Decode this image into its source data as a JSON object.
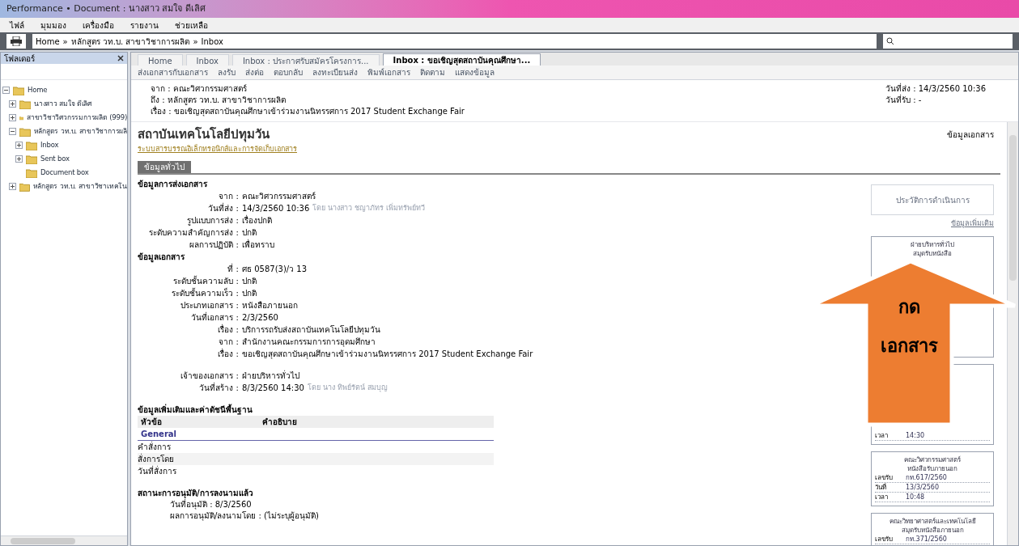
{
  "window": {
    "title": "Performance • Document : นางสาว สมใจ ดีเลิศ"
  },
  "menu": [
    "ไฟล์",
    "มุมมอง",
    "เครื่องมือ",
    "รายงาน",
    "ช่วยเหลือ"
  ],
  "address": {
    "separator": "»",
    "path": [
      "Home",
      "หลักสูตร วท.บ. สาขาวิชาการผลิต",
      "Inbox"
    ]
  },
  "folders": {
    "title": "โฟลเดอร์",
    "tree": [
      {
        "label": "Home",
        "expanded": true,
        "children": [
          {
            "label": "นางสาว สมใจ ดีเลิศ",
            "expanded": false
          },
          {
            "label": "สาขาวิชาวิศวกรรมการผลิต (999)",
            "expanded": false
          },
          {
            "label": "หลักสูตร วท.บ. สาขาวิชาการผลิ",
            "expanded": true,
            "children": [
              {
                "label": "Inbox",
                "expanded": false
              },
              {
                "label": "Sent box",
                "expanded": false
              },
              {
                "label": "Document box"
              }
            ]
          },
          {
            "label": "หลักสูตร วท.บ. สาขาวิชาเทคโน",
            "expanded": false
          }
        ]
      }
    ]
  },
  "tabs": [
    {
      "label": "Home",
      "selected": false
    },
    {
      "label": "Inbox",
      "selected": false
    },
    {
      "label": "Inbox : ประกาศรับสมัครโครงการ...",
      "selected": false
    },
    {
      "label": "Inbox : ขอเชิญสุดสถาบันคุณศึกษา...",
      "selected": true
    }
  ],
  "toolbar": [
    "ส่งเอกสารกับเอกสาร",
    "ลงรับ",
    "ส่งต่อ",
    "ตอบกลับ",
    "ลงทะเบียนส่ง",
    "พิมพ์เอกสาร",
    "ติดตาม",
    "แสดงข้อมูล"
  ],
  "header": {
    "lines": [
      "จาก : คณะวิศวกรรมศาสตร์",
      "ถึง : หลักสูตร วท.บ. สาขาวิชาการผลิต",
      "เรื่อง : ขอเชิญสุดสถาบันคุณศึกษาเข้าร่วมงานนิทรรศการ 2017 Student Exchange Fair"
    ],
    "dates": [
      "วันที่ส่ง : 14/3/2560 10:36",
      "วันที่รับ : -"
    ]
  },
  "document": {
    "title": "สถาบันเทคโนโลยีปทุมวัน",
    "subtitle": "ระบบสารบรรณอิเล็กทรอนิกส์และการจัดเก็บเอกสาร",
    "info_label": "ข้อมูลเอกสาร",
    "tab": "ข้อมูลทั่วไป",
    "sections": [
      {
        "title": "ข้อมูลการส่งเอกสาร",
        "rows": [
          {
            "label": "จาก :",
            "value": "คณะวิศวกรรมศาสตร์",
            "note": ""
          },
          {
            "label": "วันที่ส่ง :",
            "value": "14/3/2560 10:36",
            "note": "โดย นางสาว ชญาภัทร เพิ่มทรัพย์ทวี"
          },
          {
            "label": "รูปแบบการส่ง :",
            "value": "เรื่องปกติ",
            "note": ""
          },
          {
            "label": "ระดับความสำคัญการส่ง :",
            "value": "ปกติ",
            "note": ""
          },
          {
            "label": "ผลการปฏิบัติ :",
            "value": "เพื่อทราบ",
            "note": ""
          }
        ]
      },
      {
        "title": "ข้อมูลเอกสาร",
        "rows": [
          {
            "label": "ที่ :",
            "value": "ศธ 0587(3)/ว 13",
            "note": ""
          },
          {
            "label": "ระดับชั้นความลับ :",
            "value": "ปกติ",
            "note": ""
          },
          {
            "label": "ระดับชั้นความเร็ว :",
            "value": "ปกติ",
            "note": ""
          },
          {
            "label": "ประเภทเอกสาร :",
            "value": "หนังสือภายนอก",
            "note": ""
          },
          {
            "label": "วันที่เอกสาร :",
            "value": "2/3/2560",
            "note": ""
          },
          {
            "label": "เรื่อง :",
            "value": "บริการรถรับส่งสถาบันเทคโนโลยีปทุมวัน",
            "note": ""
          },
          {
            "label": "จาก :",
            "value": "สำนักงานคณะกรรมการการอุดมศึกษา",
            "note": ""
          },
          {
            "label": "เรื่อง :",
            "value": "ขอเชิญสุดสถาบันคุณศึกษาเข้าร่วมงานนิทรรศการ 2017 Student Exchange Fair",
            "note": ""
          }
        ]
      },
      {
        "rows": [
          {
            "label": "เจ้าของเอกสาร :",
            "value": "ฝ่ายบริหารทั่วไป",
            "note": ""
          },
          {
            "label": "วันที่สร้าง :",
            "value": "8/3/2560 14:30",
            "note": "โดย นาง ทิพย์รัตน์ สมบุญ"
          }
        ]
      }
    ],
    "table": {
      "title": "ข้อมูลเพิ่มเติมและค่าดัชนีพื้นฐาน",
      "columns": [
        "หัวข้อ",
        "คำอธิบาย"
      ],
      "group": "General",
      "rows": [
        "คำสั่งการ",
        "สั่งการโดย",
        "วันที่สั่งการ"
      ]
    },
    "approval": {
      "title": "สถานะการอนุมัติ/การลงนามแล้ว",
      "rows": [
        "วันที่อนุมัติ : 8/3/2560",
        "ผลการอนุมัติ/ลงนามโดย : (ไม่ระบุผู้อนุมัติ)"
      ]
    }
  },
  "side": {
    "history_button": "ประวัติการดำเนินการ",
    "more_link": "ข้อมูลเพิ่มเติม",
    "stamps": [
      {
        "heading": [
          "ฝ่ายบริหารทั่วไป",
          "สมุดรับหนังสือ"
        ]
      },
      {
        "rows": [
          {
            "label": "เวลา",
            "value": "14:30"
          }
        ]
      },
      {
        "heading": [
          "คณะวิศวกรรมศาสตร์",
          "หนังสือรับภายนอก"
        ],
        "rows": [
          {
            "label": "เลขรับ",
            "value": "กท.617/2560"
          },
          {
            "label": "วันที่",
            "value": "13/3/2560"
          },
          {
            "label": "เวลา",
            "value": "10:48"
          }
        ]
      },
      {
        "heading": [
          "คณะวิทยาศาสตร์และเทคโนโลยี",
          "สมุดรับหนังสือภายนอก"
        ],
        "rows": [
          {
            "label": "เลขรับ",
            "value": "กท.371/2560"
          }
        ]
      }
    ]
  },
  "annotation": {
    "lines": [
      "กด",
      "เอกสาร"
    ]
  }
}
